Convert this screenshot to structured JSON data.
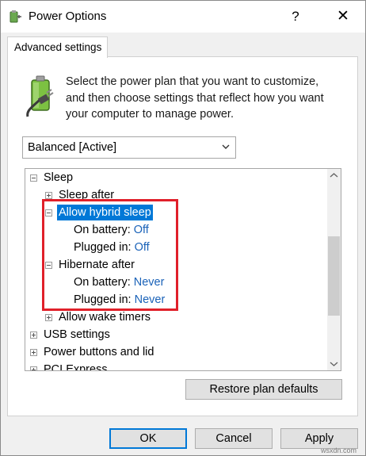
{
  "window": {
    "title": "Power Options",
    "help_label": "?",
    "close_label": "✕"
  },
  "tab": {
    "label": "Advanced settings"
  },
  "description": "Select the power plan that you want to customize, and then choose settings that reflect how you want your computer to manage power.",
  "plan_select": {
    "value": "Balanced [Active]"
  },
  "tree": {
    "sleep": "Sleep",
    "sleep_after": "Sleep after",
    "allow_hybrid_sleep": "Allow hybrid sleep",
    "hybrid_on_battery_label": "On battery:",
    "hybrid_on_battery_value": "Off",
    "hybrid_plugged_in_label": "Plugged in:",
    "hybrid_plugged_in_value": "Off",
    "hibernate_after": "Hibernate after",
    "hibernate_on_battery_label": "On battery:",
    "hibernate_on_battery_value": "Never",
    "hibernate_plugged_in_label": "Plugged in:",
    "hibernate_plugged_in_value": "Never",
    "allow_wake_timers": "Allow wake timers",
    "usb_settings": "USB settings",
    "power_buttons_and_lid": "Power buttons and lid",
    "pci_express": "PCI Express"
  },
  "buttons": {
    "restore_defaults": "Restore plan defaults",
    "ok": "OK",
    "cancel": "Cancel",
    "apply": "Apply"
  },
  "watermark": "wsxdn.com",
  "colors": {
    "selection": "#0078d7",
    "link": "#1a62b8",
    "highlight_border": "#e0202a"
  }
}
